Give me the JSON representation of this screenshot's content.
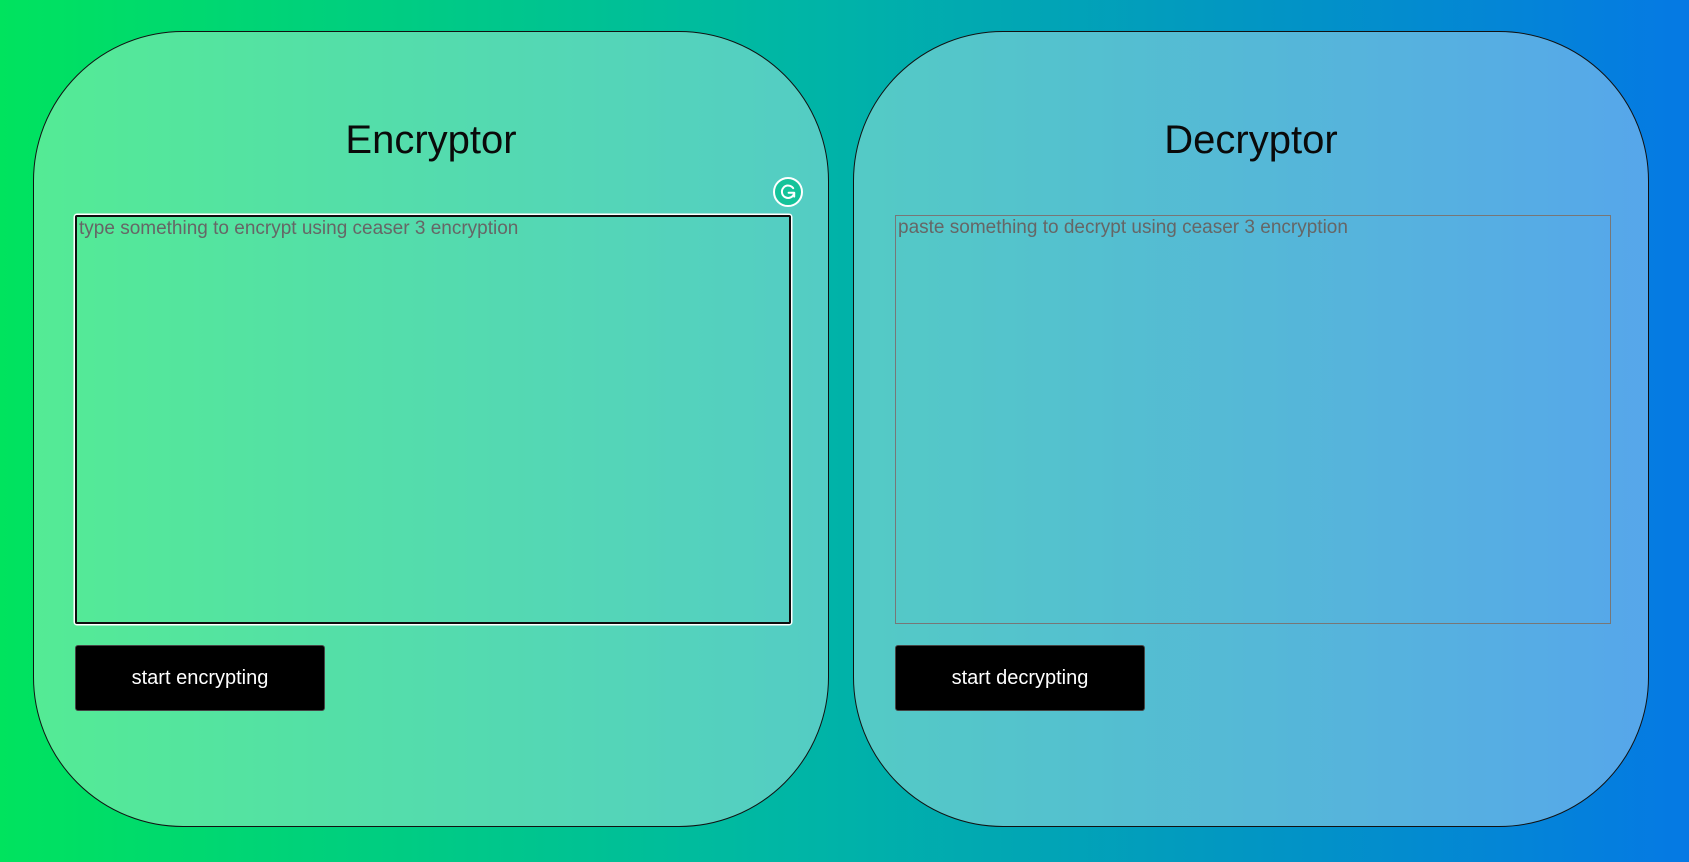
{
  "encryptor": {
    "title": "Encryptor",
    "input": {
      "value": "",
      "placeholder": "type something to encrypt using ceaser 3 encryption"
    },
    "button_label": "start encrypting"
  },
  "decryptor": {
    "title": "Decryptor",
    "input": {
      "value": "",
      "placeholder": "paste something to decrypt using ceaser 3 encryption"
    },
    "button_label": "start decrypting"
  },
  "overlay": {
    "icon": "grammarly-icon",
    "color": "#15c39a"
  },
  "colors": {
    "background_start": "#00e35e",
    "background_end": "#0579e4",
    "button": "#000000",
    "button_text": "#ffffff"
  }
}
